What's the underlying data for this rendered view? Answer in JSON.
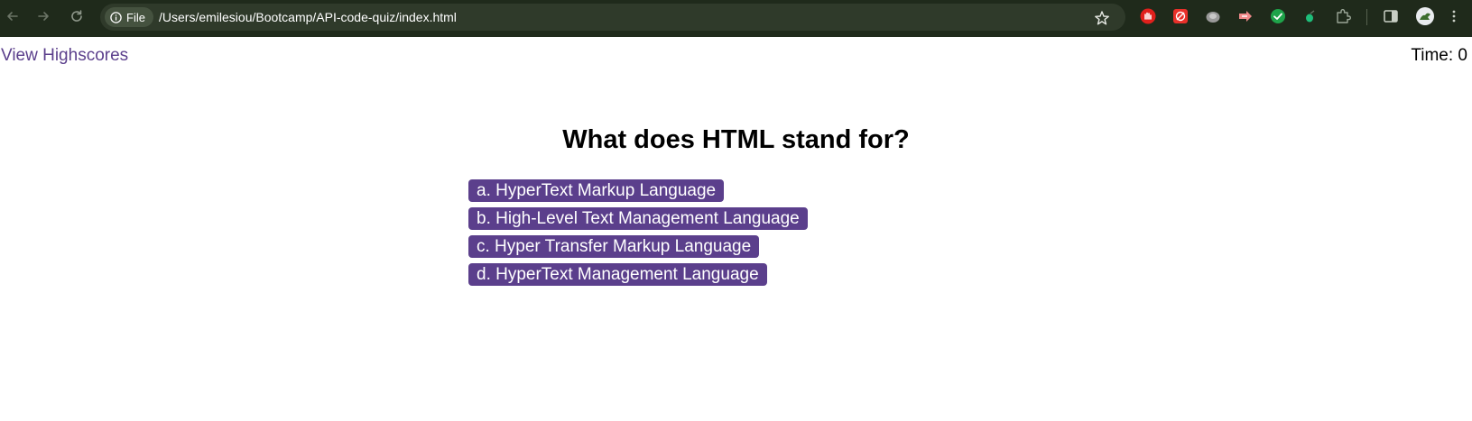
{
  "browser": {
    "site_chip_label": "File",
    "url": "/Users/emilesiou/Bootcamp/API-code-quiz/index.html",
    "nav_icons": [
      "back-arrow-icon",
      "forward-arrow-icon",
      "reload-icon"
    ],
    "bookmark_icon": "star-icon",
    "extensions": [
      {
        "name": "red-hand-extension-icon",
        "color": "#e0201c"
      },
      {
        "name": "red-grid-extension-icon",
        "color": "#e8302a"
      },
      {
        "name": "gray-shell-extension-icon",
        "color": "#9a9a9a"
      },
      {
        "name": "pink-arrow-extension-icon",
        "color": "#f08a8a"
      },
      {
        "name": "green-check-extension-icon",
        "color": "#1fa34a"
      },
      {
        "name": "teal-leaf-extension-icon",
        "color": "#1ebe7a"
      },
      {
        "name": "puzzle-extensions-icon",
        "color": "#9aa596"
      }
    ],
    "side_panel_icon": "side-panel-icon",
    "profile_icon": "profile-avatar-icon",
    "menu_icon": "kebab-menu-icon"
  },
  "header": {
    "highscores_label": "View Highscores",
    "timer_text": "Time: 0"
  },
  "quiz": {
    "question": "What does HTML stand for?",
    "answers": [
      "a. HyperText Markup Language",
      "b. High-Level Text Management Language",
      "c. Hyper Transfer Markup Language",
      "d. HyperText Management Language"
    ]
  },
  "colors": {
    "accent": "#5b3f8c",
    "chrome_bg": "#1f2a1b",
    "omnibox_bg": "#2f3a2a"
  }
}
